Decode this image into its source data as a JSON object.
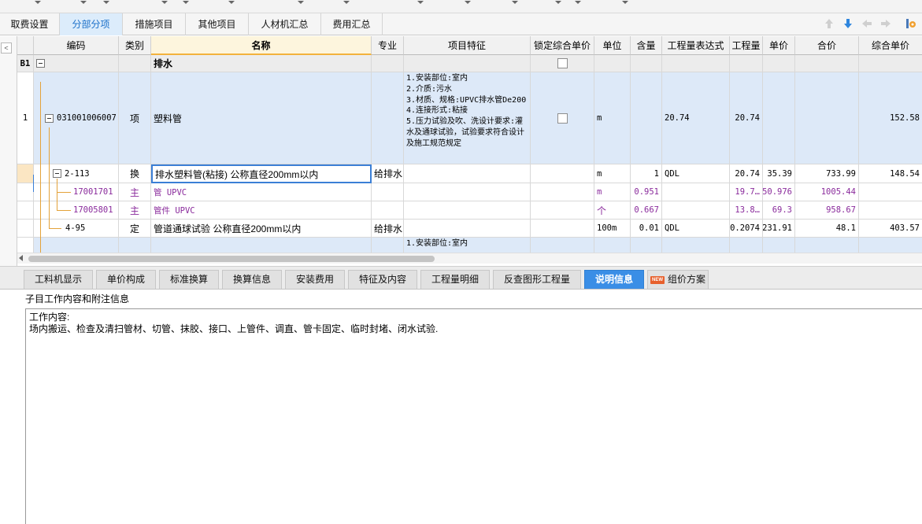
{
  "top_tabs": [
    {
      "label": "取费设置"
    },
    {
      "label": "分部分项"
    },
    {
      "label": "措施项目"
    },
    {
      "label": "其他项目"
    },
    {
      "label": "人材机汇总"
    },
    {
      "label": "费用汇总"
    }
  ],
  "active_top_tab": "分部分项",
  "toolbar_icons": [
    "arrow-up-icon",
    "arrow-down-icon",
    "arrow-left-icon",
    "arrow-right-icon",
    "settings-icon"
  ],
  "columns": [
    "编码",
    "类别",
    "名称",
    "专业",
    "项目特征",
    "锁定综合单价",
    "单位",
    "含量",
    "工程量表达式",
    "工程量",
    "单价",
    "合价",
    "综合单价"
  ],
  "rows": [
    {
      "num": "B1",
      "code": "",
      "type": "",
      "name": "排水",
      "spec": "",
      "features": "",
      "locked": false,
      "unit": "",
      "content": "",
      "expr": "",
      "qty": "",
      "price": "",
      "total": "",
      "unit_total": ""
    },
    {
      "num": "1",
      "code": "031001006007",
      "type": "项",
      "name": "塑料管",
      "spec": "",
      "features": "1.安装部位:室内\n2.介质:污水\n3.材质、规格:UPVC排水管De200\n4.连接形式:粘接\n5.压力试验及吹、洗设计要求:灌水及通球试验，试验要求符合设计及施工规范规定",
      "locked": false,
      "unit": "m",
      "content": "",
      "expr": "20.74",
      "qty": "20.74",
      "price": "",
      "total": "",
      "unit_total": "152.58"
    },
    {
      "num": "",
      "code": "2-113",
      "type": "换",
      "name": "排水塑料管(粘接) 公称直径200mm以内",
      "spec": "给排水",
      "features": "",
      "unit": "m",
      "content": "1",
      "expr": "QDL",
      "qty": "20.74",
      "price": "35.39",
      "total": "733.99",
      "unit_total": "148.54"
    },
    {
      "num": "",
      "code": "17001701",
      "type": "主",
      "name": "管 UPVC",
      "spec": "",
      "features": "",
      "unit": "m",
      "content": "0.951",
      "expr": "",
      "qty": "19.7…",
      "price": "50.976",
      "total": "1005.44",
      "unit_total": ""
    },
    {
      "num": "",
      "code": "17005801",
      "type": "主",
      "name": "管件 UPVC",
      "spec": "",
      "features": "",
      "unit": "个",
      "content": "0.667",
      "expr": "",
      "qty": "13.8…",
      "price": "69.3",
      "total": "958.67",
      "unit_total": ""
    },
    {
      "num": "",
      "code": "4-95",
      "type": "定",
      "name": "管道通球试验 公称直径200mm以内",
      "spec": "给排水",
      "features": "",
      "unit": "100m",
      "content": "0.01",
      "expr": "QDL",
      "qty": "0.2074",
      "price": "231.91",
      "total": "48.1",
      "unit_total": "403.57"
    },
    {
      "num": "",
      "code": "",
      "type": "",
      "name": "",
      "spec": "",
      "features": "1.安装部位:室内",
      "unit": "",
      "content": "",
      "expr": "",
      "qty": "",
      "price": "",
      "total": "",
      "unit_total": ""
    }
  ],
  "bottom_tabs": [
    {
      "label": "工料机显示"
    },
    {
      "label": "单价构成"
    },
    {
      "label": "标准换算"
    },
    {
      "label": "换算信息"
    },
    {
      "label": "安装费用"
    },
    {
      "label": "特征及内容"
    },
    {
      "label": "工程量明细"
    },
    {
      "label": "反查图形工程量"
    },
    {
      "label": "说明信息"
    },
    {
      "label": "组价方案",
      "badge": "NEW"
    }
  ],
  "active_bottom_tab": "说明信息",
  "panel": {
    "title": "子目工作内容和附注信息",
    "line1": "工作内容:",
    "line2": "场内搬运、检查及清扫管材、切管、抹胶、接口、上管件、调直、管卡固定、临时封堵、闭水试验."
  },
  "colors": {
    "accent_blue": "#3a8ee6",
    "selected_row_bg": "#dde9f8",
    "material_text": "#8a2b9c",
    "tree_line": "#e3a23a"
  }
}
